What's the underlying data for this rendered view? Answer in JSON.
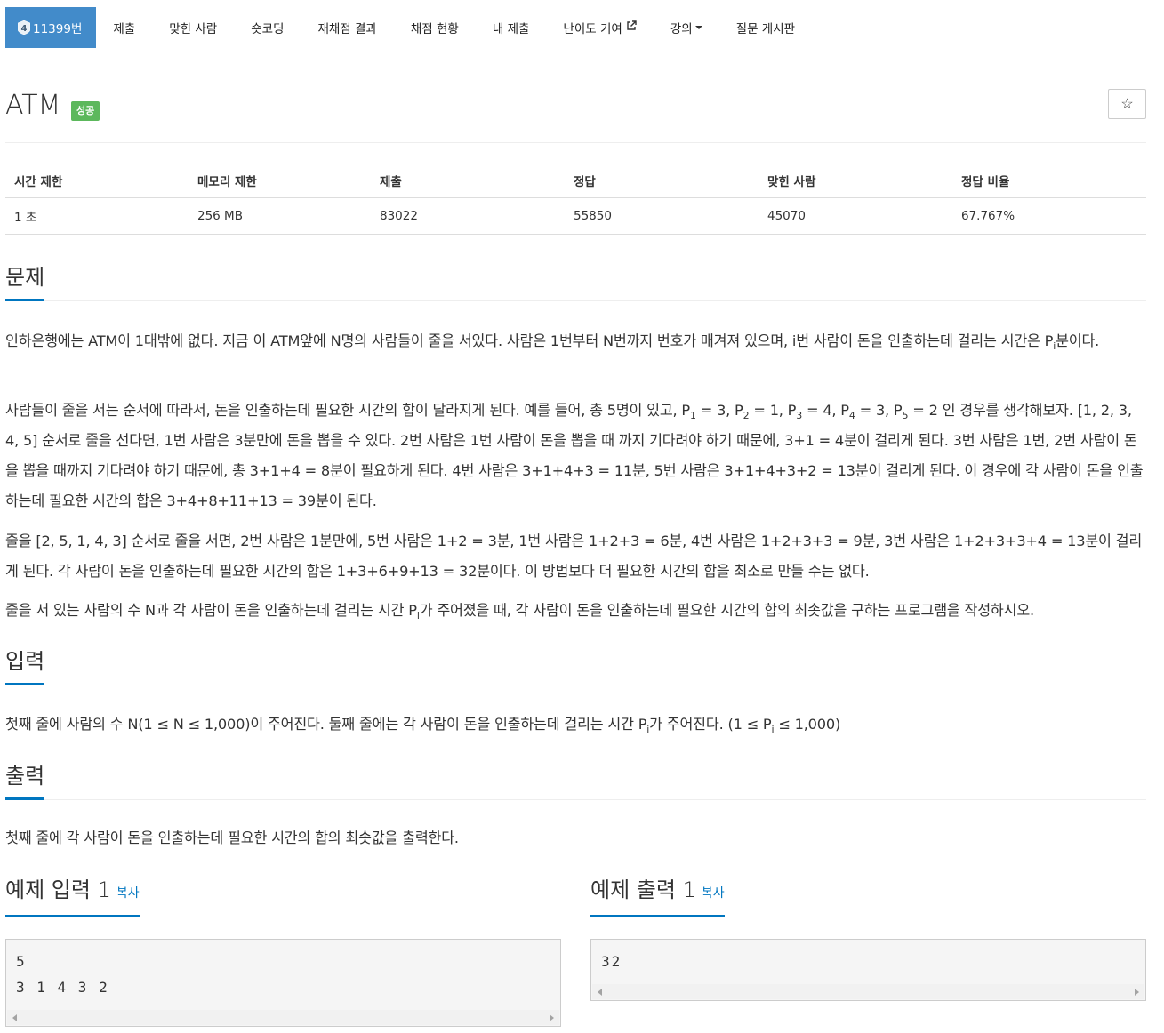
{
  "nav": {
    "problem_id_label": "11399번",
    "tier_icon": "tier-silver-4-badge",
    "items": [
      {
        "label": "제출"
      },
      {
        "label": "맞힌 사람"
      },
      {
        "label": "숏코딩"
      },
      {
        "label": "재채점 결과"
      },
      {
        "label": "채점 현황"
      },
      {
        "label": "내 제출"
      },
      {
        "label": "난이도 기여",
        "icon": "external-link-icon"
      },
      {
        "label": "강의",
        "icon": "caret-down-icon"
      },
      {
        "label": "질문 게시판"
      }
    ]
  },
  "problem": {
    "title": "ATM",
    "status": "성공",
    "star_icon": "☆"
  },
  "info": {
    "headers": [
      "시간 제한",
      "메모리 제한",
      "제출",
      "정답",
      "맞힌 사람",
      "정답 비율"
    ],
    "values": [
      "1 초",
      "256 MB",
      "83022",
      "55850",
      "45070",
      "67.767%"
    ]
  },
  "sections": {
    "description_title": "문제",
    "input_title": "입력",
    "output_title": "출력"
  },
  "description": {
    "p1_a": "인하은행에는 ATM이 1대밖에 없다. 지금 이 ATM앞에 N명의 사람들이 줄을 서있다. 사람은 1번부터 N번까지 번호가 매겨져 있으며, i번 사람이 돈을 인출하는데 걸리는 시간은 P",
    "p1_sub": "i",
    "p1_b": "분이다.",
    "p2_a": "사람들이 줄을 서는 순서에 따라서, 돈을 인출하는데 필요한 시간의 합이 달라지게 된다. 예를 들어, 총 5명이 있고, P",
    "p2_s1": "1",
    "p2_b": " = 3, P",
    "p2_s2": "2",
    "p2_c": " = 1, P",
    "p2_s3": "3",
    "p2_d": " = 4, P",
    "p2_s4": "4",
    "p2_e": " = 3, P",
    "p2_s5": "5",
    "p2_f": " = 2 인 경우를 생각해보자. [1, 2, 3, 4, 5] 순서로 줄을 선다면, 1번 사람은 3분만에 돈을 뽑을 수 있다. 2번 사람은 1번 사람이 돈을 뽑을 때 까지 기다려야 하기 때문에, 3+1 = 4분이 걸리게 된다. 3번 사람은 1번, 2번 사람이 돈을 뽑을 때까지 기다려야 하기 때문에, 총 3+1+4 = 8분이 필요하게 된다. 4번 사람은 3+1+4+3 = 11분, 5번 사람은 3+1+4+3+2 = 13분이 걸리게 된다. 이 경우에 각 사람이 돈을 인출하는데 필요한 시간의 합은 3+4+8+11+13 = 39분이 된다.",
    "p3": "줄을 [2, 5, 1, 4, 3] 순서로 줄을 서면, 2번 사람은 1분만에, 5번 사람은 1+2 = 3분, 1번 사람은 1+2+3 = 6분, 4번 사람은 1+2+3+3 = 9분, 3번 사람은 1+2+3+3+4 = 13분이 걸리게 된다. 각 사람이 돈을 인출하는데 필요한 시간의 합은 1+3+6+9+13 = 32분이다. 이 방법보다 더 필요한 시간의 합을 최소로 만들 수는 없다.",
    "p4_a": "줄을 서 있는 사람의 수 N과 각 사람이 돈을 인출하는데 걸리는 시간 P",
    "p4_sub": "i",
    "p4_b": "가 주어졌을 때, 각 사람이 돈을 인출하는데 필요한 시간의 합의 최솟값을 구하는 프로그램을 작성하시오."
  },
  "input_desc": {
    "a": "첫째 줄에 사람의 수 N(1 ≤ N ≤ 1,000)이 주어진다. 둘째 줄에는 각 사람이 돈을 인출하는데 걸리는 시간 P",
    "s1": "i",
    "b": "가 주어진다. (1 ≤ P",
    "s2": "i",
    "c": " ≤ 1,000)"
  },
  "output_desc": "첫째 줄에 각 사람이 돈을 인출하는데 필요한 시간의 합의 최솟값을 출력한다.",
  "samples": {
    "input_title": "예제 입력 1",
    "output_title": "예제 출력 1",
    "copy_label": "복사",
    "input_text": "5\n3 1 4 3 2",
    "output_text": "32"
  }
}
